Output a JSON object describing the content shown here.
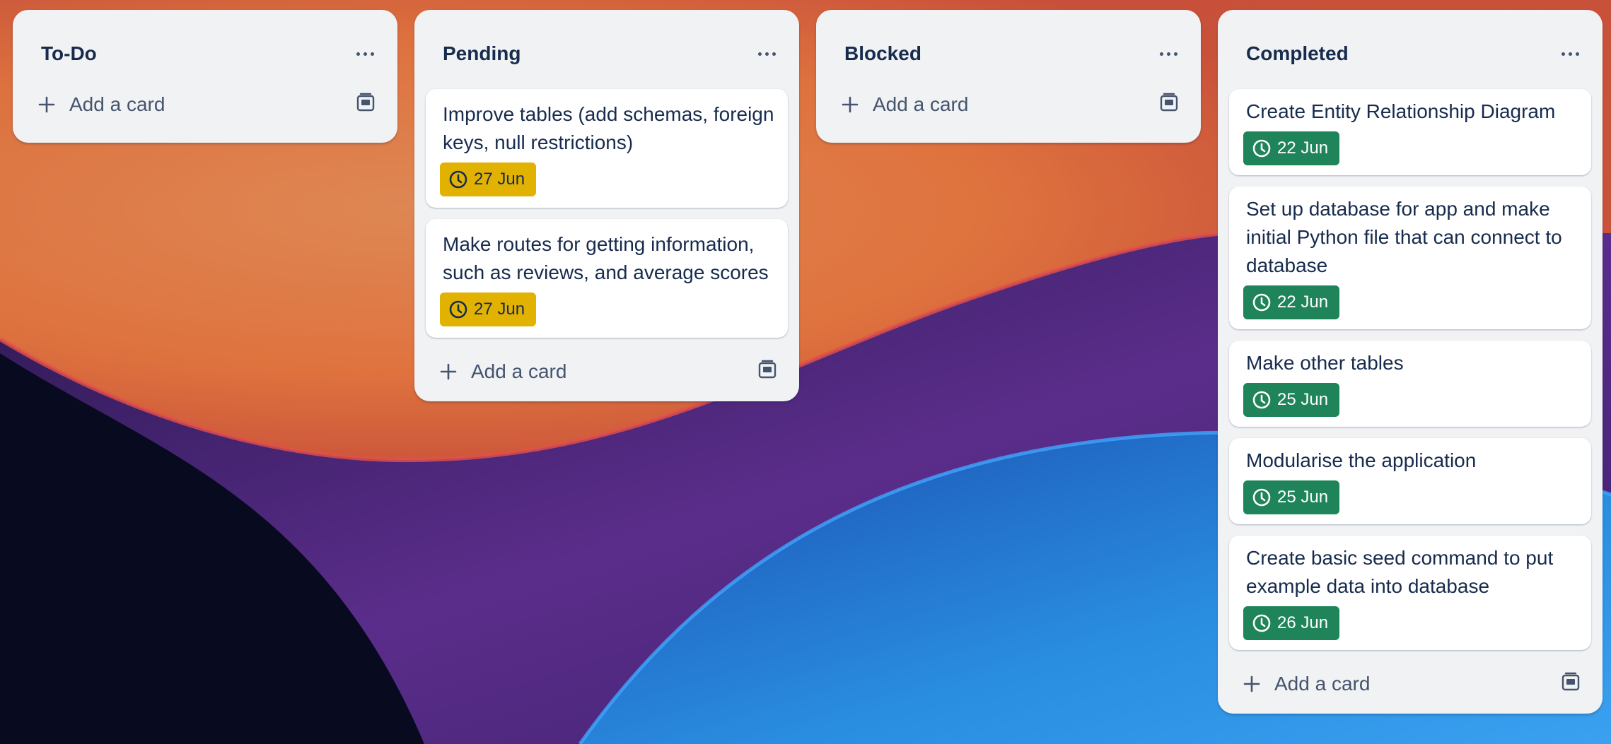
{
  "board": {
    "colors": {
      "list_bg": "#f1f2f4",
      "text": "#172b4d",
      "muted": "#44546f",
      "due_soon": "#e2b203",
      "complete": "#1f845a"
    },
    "lists": [
      {
        "title": "To-Do",
        "add_label": "Add a card",
        "cards": []
      },
      {
        "title": "Pending",
        "add_label": "Add a card",
        "cards": [
          {
            "title": "Improve tables (add schemas, foreign keys, null restrictions)",
            "due": "27 Jun",
            "status": "due-soon"
          },
          {
            "title": "Make routes for getting information, such as reviews, and average scores",
            "due": "27 Jun",
            "status": "due-soon"
          }
        ]
      },
      {
        "title": "Blocked",
        "add_label": "Add a card",
        "cards": []
      },
      {
        "title": "Completed",
        "add_label": "Add a card",
        "cards": [
          {
            "title": "Create Entity Relationship Diagram",
            "due": "22 Jun",
            "status": "complete"
          },
          {
            "title": "Set up database for app and make initial Python file that can connect to database",
            "due": "22 Jun",
            "status": "complete"
          },
          {
            "title": "Make other tables",
            "due": "25 Jun",
            "status": "complete"
          },
          {
            "title": "Modularise the application",
            "due": "25 Jun",
            "status": "complete"
          },
          {
            "title": "Create basic seed command to put example data into database",
            "due": "26 Jun",
            "status": "complete"
          }
        ]
      }
    ],
    "icons": {
      "list_menu": "more-horizontal-icon",
      "add": "plus-icon",
      "template": "card-template-icon",
      "due": "clock-icon"
    }
  }
}
